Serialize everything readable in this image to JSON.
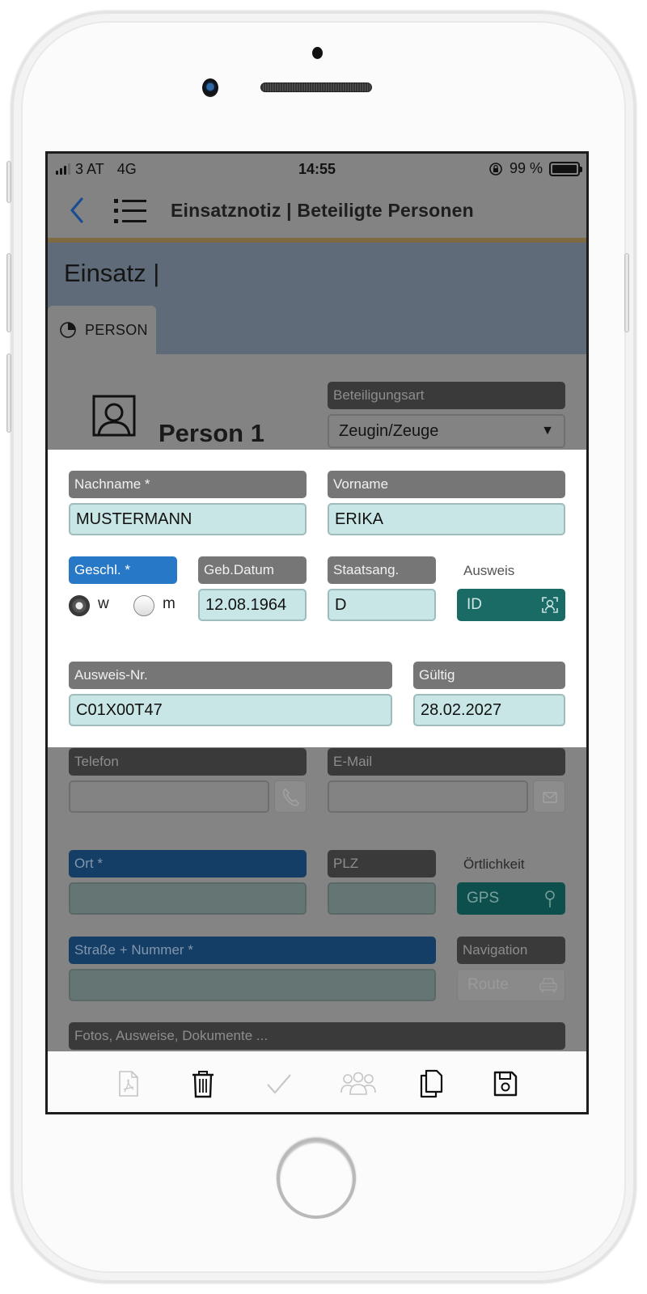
{
  "status_bar": {
    "carrier": "3 AT",
    "network": "4G",
    "time": "14:55",
    "battery_percent_label": "99 %",
    "battery_level": 0.99,
    "signal_bars": 3,
    "signal_bars_total": 4
  },
  "nav": {
    "title": "Einsatznotiz | Beteiligte Personen"
  },
  "einsatz": {
    "title": "Einsatz |"
  },
  "tabs": [
    {
      "label": "PERSON",
      "icon": "pie-chart-icon",
      "active": true
    }
  ],
  "person": {
    "title": "Person 1",
    "participation": {
      "label": "Beteiligungsart",
      "value": "Zeugin/Zeuge"
    }
  },
  "form": {
    "nachname": {
      "label": "Nachname *",
      "value": "MUSTERMANN"
    },
    "vorname": {
      "label": "Vorname",
      "value": "ERIKA"
    },
    "geschlecht": {
      "label": "Geschl. *",
      "options": [
        {
          "label": "w",
          "selected": true
        },
        {
          "label": "m",
          "selected": false
        }
      ]
    },
    "geburtsdatum": {
      "label": "Geb.Datum",
      "value": "12.08.1964"
    },
    "staatsangehoerigkeit": {
      "label": "Staatsang.",
      "value": "D"
    },
    "ausweis": {
      "label": "Ausweis",
      "button_label": "ID",
      "icon": "face-scan-icon"
    },
    "ausweis_nr": {
      "label": "Ausweis-Nr.",
      "value": "C01X00T47"
    },
    "gueltig": {
      "label": "Gültig",
      "value": "28.02.2027"
    },
    "telefon": {
      "label": "Telefon",
      "value": "",
      "icon": "phone-icon"
    },
    "email": {
      "label": "E-Mail",
      "value": "",
      "icon": "mail-icon"
    },
    "ort": {
      "label": "Ort *",
      "value": ""
    },
    "plz": {
      "label": "PLZ",
      "value": ""
    },
    "oertlichkeit": {
      "label": "Örtlichkeit",
      "button_label": "GPS",
      "icon": "map-pin-icon"
    },
    "strasse": {
      "label": "Straße + Nummer *",
      "value": ""
    },
    "navigation": {
      "label": "Navigation",
      "button_label": "Route",
      "icon": "car-icon"
    },
    "dokumente": {
      "label": "Fotos, Ausweise, Dokumente ..."
    }
  },
  "toolbar": {
    "items": [
      {
        "name": "pdf",
        "icon": "pdf-file-icon",
        "enabled": false
      },
      {
        "name": "delete",
        "icon": "trash-icon",
        "enabled": true
      },
      {
        "name": "confirm",
        "icon": "checkmark-icon",
        "enabled": false
      },
      {
        "name": "group",
        "icon": "people-group-icon",
        "enabled": false
      },
      {
        "name": "copy",
        "icon": "copy-icon",
        "enabled": true
      },
      {
        "name": "save",
        "icon": "save-icon",
        "enabled": true
      }
    ]
  }
}
